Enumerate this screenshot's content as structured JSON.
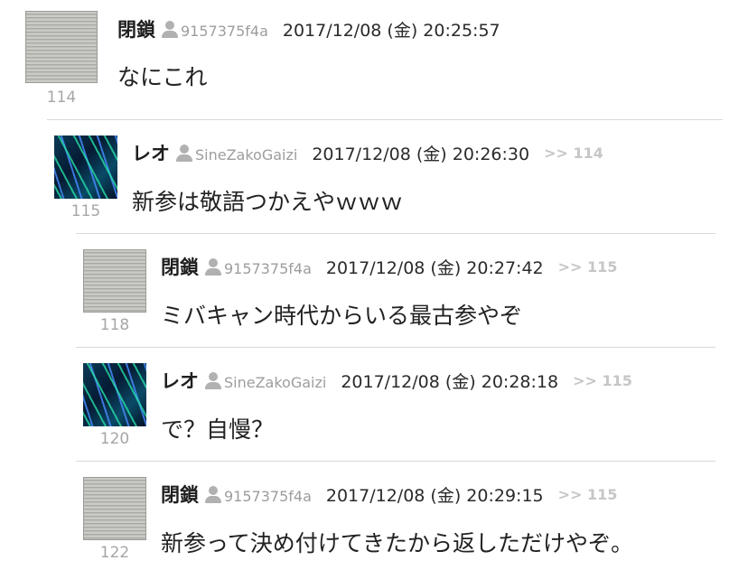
{
  "posts": [
    {
      "number": "114",
      "username": "閉鎖",
      "user_id": "9157375f4a",
      "timestamp": "2017/12/08 (金) 20:25:57",
      "reply_to": "",
      "body": "なにこれ",
      "avatar": "gray-striped-avatar"
    },
    {
      "number": "115",
      "username": "レオ",
      "user_id": "SineZakoGaizi",
      "timestamp": "2017/12/08 (金) 20:26:30",
      "reply_to": ">> 114",
      "body": "新参は敬語つかえやｗｗｗ",
      "avatar": "neon-lines-avatar"
    },
    {
      "number": "118",
      "username": "閉鎖",
      "user_id": "9157375f4a",
      "timestamp": "2017/12/08 (金) 20:27:42",
      "reply_to": ">> 115",
      "body": "ミバキャン時代からいる最古参やぞ",
      "avatar": "gray-striped-avatar"
    },
    {
      "number": "120",
      "username": "レオ",
      "user_id": "SineZakoGaizi",
      "timestamp": "2017/12/08 (金) 20:28:18",
      "reply_to": ">> 115",
      "body": "で？自慢？",
      "avatar": "neon-lines-avatar"
    },
    {
      "number": "122",
      "username": "閉鎖",
      "user_id": "9157375f4a",
      "timestamp": "2017/12/08 (金) 20:29:15",
      "reply_to": ">> 115",
      "body": "新参って決め付けてきたから返しただけやぞ。",
      "avatar": "gray-striped-avatar"
    }
  ],
  "colors": {
    "username": "#1e1e1e",
    "user_id": "#9d9d9d",
    "reply_link": "#c6c6c6",
    "post_number": "#a6a6a6",
    "divider": "#d9d9d9"
  }
}
